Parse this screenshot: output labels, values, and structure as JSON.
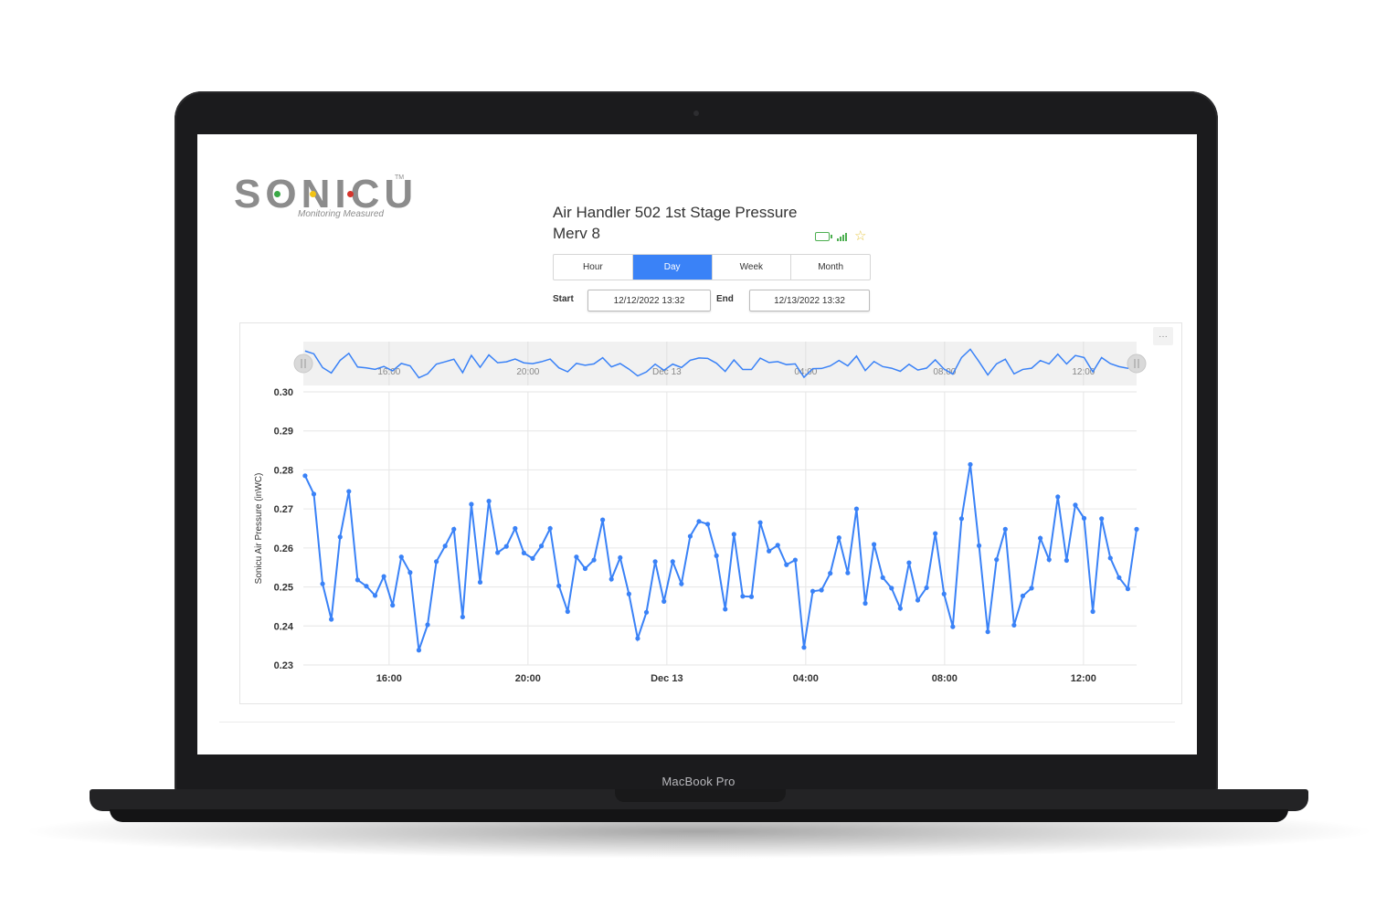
{
  "device_label": "MacBook Pro",
  "logo": {
    "wordmark": "SONICU",
    "tm": "TM",
    "tagline": "Monitoring Measured"
  },
  "sensor": {
    "title": "Air Handler 502 1st Stage Pressure",
    "subtitle": "Merv 8"
  },
  "status_icons": [
    "battery-icon",
    "signal-icon",
    "star-icon"
  ],
  "tabs": [
    {
      "label": "Hour",
      "active": false
    },
    {
      "label": "Day",
      "active": true
    },
    {
      "label": "Week",
      "active": false
    },
    {
      "label": "Month",
      "active": false
    }
  ],
  "range": {
    "start_label": "Start",
    "start_value": "12/12/2022 13:32",
    "end_label": "End",
    "end_value": "12/13/2022 13:32"
  },
  "menu_glyph": "···",
  "colors": {
    "series": "#3a82f7",
    "active_tab": "#3a82f7",
    "navigator_bg": "#f1f1f1"
  },
  "chart_data": {
    "type": "line",
    "ylabel": "Sonicu Air Pressure (inWC)",
    "ylim": [
      0.23,
      0.3
    ],
    "yticks": [
      "0.23",
      "0.24",
      "0.25",
      "0.26",
      "0.27",
      "0.28",
      "0.29",
      "0.30"
    ],
    "x_start_hours": 13.53,
    "x_end_hours": 37.53,
    "xticks": [
      {
        "label": "16:00",
        "hour": 16
      },
      {
        "label": "20:00",
        "hour": 20
      },
      {
        "label": "Dec 13",
        "hour": 24
      },
      {
        "label": "04:00",
        "hour": 28
      },
      {
        "label": "08:00",
        "hour": 32
      },
      {
        "label": "12:00",
        "hour": 36
      }
    ],
    "navigator_ticks": [
      "16:00",
      "20:00",
      "Dec 13",
      "04:00",
      "08:00",
      "12:00"
    ],
    "grid": true,
    "series": [
      {
        "values": [
          0.2785,
          0.2738,
          0.2508,
          0.2417,
          0.2628,
          0.2745,
          0.2518,
          0.2502,
          0.2478,
          0.2527,
          0.2453,
          0.2577,
          0.2537,
          0.2338,
          0.2403,
          0.2565,
          0.2605,
          0.2648,
          0.2423,
          0.2712,
          0.2512,
          0.272,
          0.2588,
          0.2604,
          0.265,
          0.2587,
          0.2573,
          0.2605,
          0.265,
          0.2503,
          0.2437,
          0.2577,
          0.2547,
          0.2569,
          0.2672,
          0.252,
          0.2575,
          0.2482,
          0.2368,
          0.2435,
          0.2565,
          0.2463,
          0.2565,
          0.2508,
          0.263,
          0.2668,
          0.2661,
          0.258,
          0.2443,
          0.2635,
          0.2476,
          0.2475,
          0.2665,
          0.2592,
          0.2607,
          0.2557,
          0.2569,
          0.2345,
          0.2489,
          0.2492,
          0.2535,
          0.2626,
          0.2536,
          0.27,
          0.2458,
          0.2609,
          0.2524,
          0.2497,
          0.2445,
          0.2562,
          0.2466,
          0.2498,
          0.2637,
          0.2482,
          0.2398,
          0.2675,
          0.2814,
          0.2606,
          0.2385,
          0.257,
          0.2648,
          0.2402,
          0.2477,
          0.2497,
          0.2625,
          0.257,
          0.2731,
          0.2568,
          0.271,
          0.2676,
          0.2437,
          0.2675,
          0.2574,
          0.2524,
          0.2495,
          0.2648
        ]
      }
    ]
  }
}
